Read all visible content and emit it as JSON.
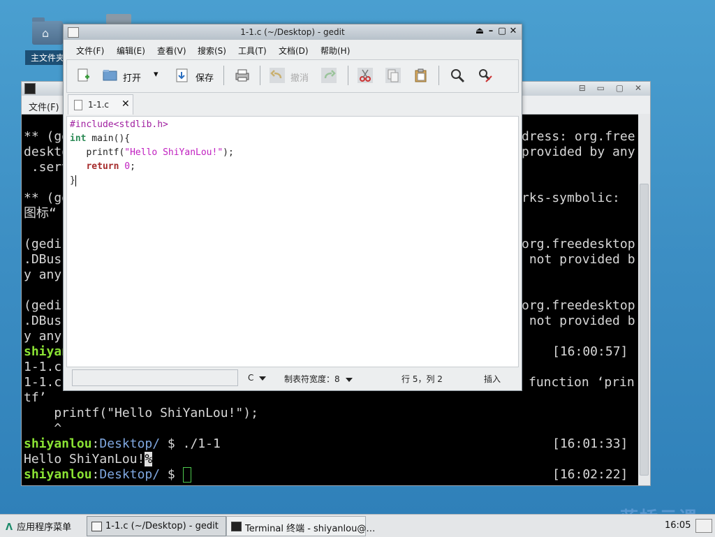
{
  "desktop": {
    "home_folder_label": "主文件夹"
  },
  "terminal": {
    "menu_file": "文件(F)",
    "lines_left": [
      {
        "t": "** (ge",
        "row": 0
      },
      {
        "t": "deskto",
        "row": 1
      },
      {
        "t": " .serv",
        "row": 2
      },
      {
        "t": "** (ge",
        "row": 4
      },
      {
        "t": "图标“",
        "row": 5
      },
      {
        "t": "(gedi",
        "row": 7
      },
      {
        "t": ".DBus",
        "row": 8
      },
      {
        "t": "y any",
        "row": 9
      },
      {
        "t": "(gedi",
        "row": 11
      },
      {
        "t": ".DBus",
        "row": 12
      },
      {
        "t": "y any",
        "row": 13
      }
    ],
    "lines_right": [
      {
        "t": "dress: org.free",
        "row": 0
      },
      {
        "t": "provided by any",
        "row": 1
      },
      {
        "t": "rks-symbolic:",
        "row": 4
      },
      {
        "t": "org.freedesktop",
        "row": 7
      },
      {
        "t": " not provided b",
        "row": 8
      },
      {
        "t": "org.freedesktop",
        "row": 11
      },
      {
        "t": " not provided b",
        "row": 12
      }
    ],
    "compile_user_frag": "shiyan",
    "ts1": "[16:00:57]",
    "err_frag1": "1-1.c",
    "err_frag2": "1-1.c",
    "err_right": "function ‘prin",
    "err_tf": "tf’",
    "err_code": "    printf(\"Hello ShiYanLou!\");",
    "err_caret": "    ^",
    "prompt_user": "shiyanlou",
    "prompt_sep": ":",
    "prompt_dir": "Desktop/",
    "prompt_sym": " $ ",
    "cmd_run": "./1-1",
    "ts2": "[16:01:33]",
    "output": "Hello ShiYanLou!",
    "output_mark": "%",
    "ts3": "[16:02:22]"
  },
  "gedit": {
    "title": "1-1.c (~/Desktop) - gedit",
    "menus": [
      "文件(F)",
      "编辑(E)",
      "查看(V)",
      "搜索(S)",
      "工具(T)",
      "文档(D)",
      "帮助(H)"
    ],
    "toolbar": {
      "open_label": "打开",
      "save_label": "保存",
      "undo_label": "撤消"
    },
    "tab_label": "1-1.c",
    "code": {
      "l1": "#include<stdlib.h>",
      "l2_type": "int",
      "l2_rest": " main(){",
      "l3_fn": "   printf(",
      "l3_str": "\"Hello ShiYanLou!\"",
      "l3_end": ");",
      "l4_kw": "return",
      "l4_num": "0",
      "l4_end": ";",
      "l5": "}"
    },
    "status": {
      "language": "C",
      "tab_width": "制表符宽度：8",
      "position": "行 5，列 2",
      "mode": "插入"
    }
  },
  "taskbar": {
    "start_label": "应用程序菜单",
    "task_gedit": "1-1.c (~/Desktop) - gedit",
    "task_terminal": "Terminal 终端 - shiyanlou@…",
    "clock": "16:05",
    "watermark": "蓝桥云课"
  },
  "colors": {
    "desktop_bg": "#3d8fc4",
    "prompt_green": "#8ae234",
    "prompt_blue": "#7fa7e0"
  }
}
